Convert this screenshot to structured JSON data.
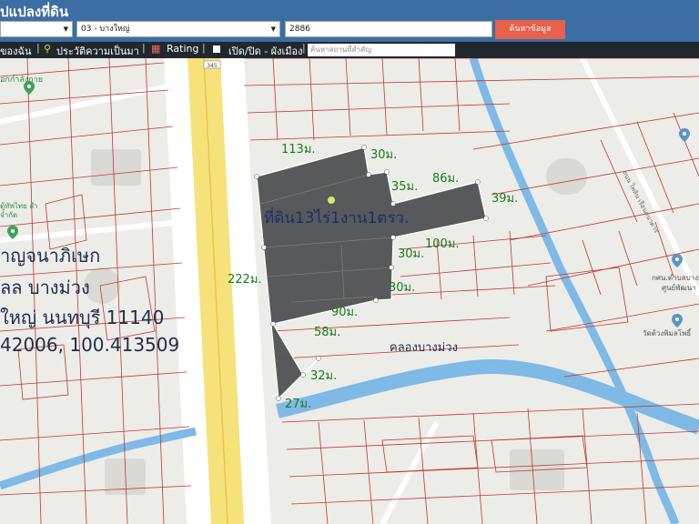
{
  "header": {
    "title": "ปแปลงที่ดิน",
    "province_select": "",
    "district_select": "03 - บางใหญ่",
    "parcel_input": "2886",
    "search_button": "ค้นหาข้อมูล"
  },
  "toolbar": {
    "item_owner": "ของฉัน",
    "item_history": "ประวัติความเป็นมา",
    "item_rating": "Rating",
    "item_toggle": "เปิด/ปิด - ผังเมือง",
    "search_placeholder": "ค้นหาสถานที่สำคัญ"
  },
  "map": {
    "plot_label": "ที่ดิน13ไร่1งาน1ตรว.",
    "canal_label": "คลองบางม่วง",
    "highway_shield": "345",
    "road_label": "ถนน ไพลิน เรือนตนาคาร",
    "place_top_left": "อกกำลังกาย",
    "place_left": "ตู้ทัพไทย สำ จำกัด",
    "place_right_1": "กศน.ตำบลบางม่วง",
    "place_right_2": "ศูนย์พัฒนา",
    "place_right_3": "วัดต้วงพิมลโพธิ์",
    "measurements": {
      "m113": "113ม.",
      "m30a": "30ม.",
      "m35": "35ม.",
      "m86": "86ม.",
      "m39": "39ม.",
      "m100": "100ม.",
      "m30b": "30ม.",
      "m222": "222ม.",
      "m30c": "30ม.",
      "m90": "90ม.",
      "m58": "58ม.",
      "m32": "32ม.",
      "m27": "27ม."
    }
  },
  "address": {
    "line1": "าญจนาภิเษก",
    "line2": "ลล บางม่วง",
    "line3": "ใหญ่ นนทบุรี 11140",
    "line4": "42006, 100.413509"
  },
  "colors": {
    "header_bg": "#3d6ea3",
    "toolbar_bg": "#20272d",
    "search_button": "#e7614c",
    "parcel_line": "#c0392b",
    "plot_fill": "#505254",
    "highway": "#f5e27a",
    "canal": "#7fb9e6",
    "measurement_text": "#1b7a1b"
  }
}
